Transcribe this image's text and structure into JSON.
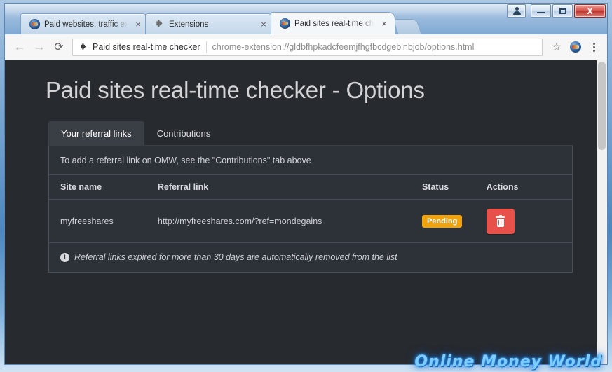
{
  "window": {
    "controls": {
      "user_label": "user-profile",
      "minimize_label": "",
      "maximize_label": "",
      "close_label": "X"
    }
  },
  "browser": {
    "tabs": [
      {
        "title": "Paid websites, traffic exc",
        "favicon": "globe-favicon",
        "close": "×",
        "active": false
      },
      {
        "title": "Extensions",
        "favicon": "puzzle-favicon",
        "close": "×",
        "active": false
      },
      {
        "title": "Paid sites real-time chec",
        "favicon": "globe-favicon",
        "close": "×",
        "active": true
      }
    ],
    "new_tab_label": "",
    "toolbar": {
      "back": "←",
      "forward": "→",
      "reload": "⟳",
      "bookmark_star": "☆",
      "menu": "kebab-menu"
    },
    "omnibox": {
      "extension_name": "Paid sites real-time checker",
      "url": "chrome-extension://gldbfhpkadcfeemjfhgfbcdgeblnbjob/options.html"
    }
  },
  "page": {
    "title": "Paid sites real-time checker - Options",
    "tabs": [
      {
        "label": "Your referral links",
        "active": true
      },
      {
        "label": "Contributions",
        "active": false
      }
    ],
    "note": "To add a referral link on OMW, see the \"Contributions\" tab above",
    "table": {
      "headers": [
        "Site name",
        "Referral link",
        "Status",
        "Actions"
      ],
      "rows": [
        {
          "site_name": "myfreeshares",
          "referral_link": "http://myfreeshares.com/?ref=mondegains",
          "status": "Pending",
          "status_color": "#f0a30a",
          "action_icon": "trash-icon"
        }
      ]
    },
    "footer_note": "Referral links expired for more than 30 days are automatically removed from the list",
    "footer_icon": "i",
    "watermark": "Online Money World",
    "accent_color": "#e8514a",
    "panel_bg": "#2d3238",
    "page_bg": "#272a2e"
  }
}
